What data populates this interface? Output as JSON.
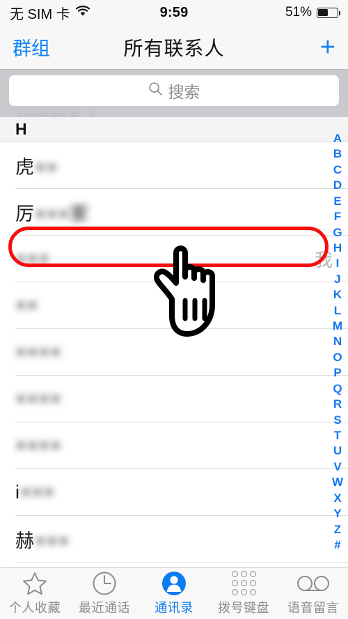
{
  "status_bar": {
    "carrier": "无 SIM 卡",
    "wifi_icon": "wifi-icon",
    "time": "9:59",
    "battery_percent": "51%",
    "battery_level": 51
  },
  "nav_bar": {
    "left_button": "群组",
    "title": "所有联系人",
    "add_button": "+",
    "accent_color": "#1184f5"
  },
  "search": {
    "placeholder": "搜索",
    "value": "",
    "icon": "search-icon",
    "ghost_text": "切换联系人"
  },
  "list": {
    "section_header": "H",
    "contacts": [
      {
        "name": "虎××",
        "prefix": "虎",
        "masked": "××",
        "me": ""
      },
      {
        "name": "厉×××家",
        "prefix": "厉",
        "masked": "×××家",
        "me": ""
      },
      {
        "name": "×××",
        "prefix": "",
        "masked": "×××",
        "me": "我"
      },
      {
        "name": "××",
        "prefix": "",
        "masked": "××",
        "me": ""
      },
      {
        "name": "××××",
        "prefix": "",
        "masked": "××××",
        "me": ""
      },
      {
        "name": "××××",
        "prefix": "",
        "masked": "××××",
        "me": ""
      },
      {
        "name": "××××",
        "prefix": "",
        "masked": "××××",
        "me": ""
      },
      {
        "name": "i×××",
        "prefix": "i",
        "masked": "×××",
        "me": ""
      },
      {
        "name": "赫×××",
        "prefix": "赫",
        "masked": "×××",
        "me": ""
      }
    ],
    "highlighted_row_index": 2,
    "highlight_color": "#f60d0d"
  },
  "index_bar": {
    "letters": [
      "A",
      "B",
      "C",
      "D",
      "E",
      "F",
      "G",
      "H",
      "I",
      "J",
      "K",
      "L",
      "M",
      "N",
      "O",
      "P",
      "Q",
      "R",
      "S",
      "T",
      "U",
      "V",
      "W",
      "X",
      "Y",
      "Z",
      "#"
    ],
    "color": "#1876f2"
  },
  "cursor": {
    "icon": "pointing-hand-cursor"
  },
  "tab_bar": {
    "active_index": 2,
    "active_color": "#0b7bf0",
    "inactive_color": "#8b8b90",
    "items": [
      {
        "label": "个人收藏",
        "icon": "star-icon"
      },
      {
        "label": "最近通话",
        "icon": "clock-icon"
      },
      {
        "label": "通讯录",
        "icon": "person-circle-icon"
      },
      {
        "label": "拨号键盘",
        "icon": "keypad-dots-icon"
      },
      {
        "label": "语音留言",
        "icon": "voicemail-icon"
      }
    ]
  }
}
